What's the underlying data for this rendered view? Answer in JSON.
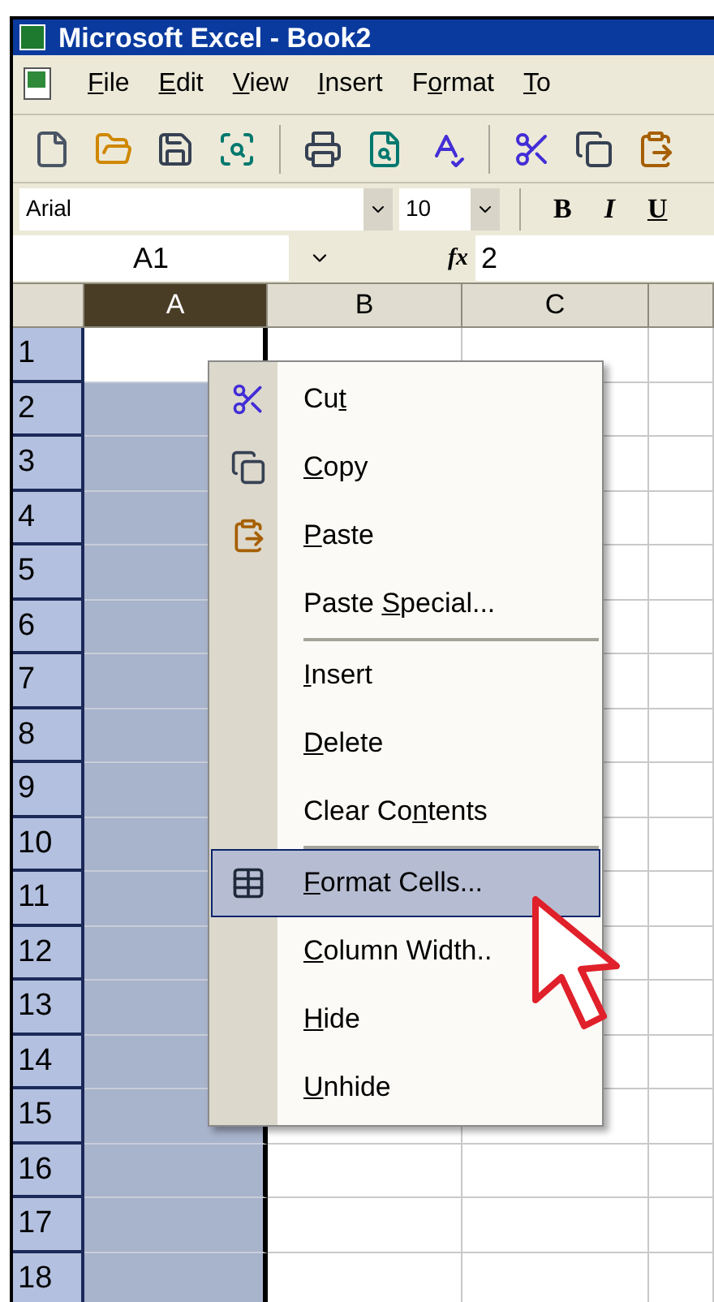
{
  "window": {
    "title": "Microsoft Excel - Book2"
  },
  "menu_bar": [
    {
      "key": "F",
      "after": "ile"
    },
    {
      "key": "E",
      "after": "dit"
    },
    {
      "key": "V",
      "after": "iew"
    },
    {
      "key": "I",
      "after": "nsert"
    },
    {
      "before": "F",
      "key": "o",
      "after": "rmat"
    },
    {
      "key": "T",
      "after": "o"
    }
  ],
  "toolbar": [
    {
      "kind": "new"
    },
    {
      "kind": "open"
    },
    {
      "kind": "save"
    },
    {
      "kind": "permission"
    },
    {
      "kind": "sep"
    },
    {
      "kind": "print"
    },
    {
      "kind": "preview"
    },
    {
      "kind": "spelling"
    },
    {
      "kind": "sep"
    },
    {
      "kind": "cut"
    },
    {
      "kind": "copy"
    },
    {
      "kind": "paste"
    }
  ],
  "formatting": {
    "font": "Arial",
    "size": "10",
    "bold": "B",
    "italic": "I",
    "underline": "U"
  },
  "formula_bar": {
    "name_box": "A1",
    "fx": "fx",
    "value": "2"
  },
  "columns": [
    {
      "label": "A",
      "selected": true
    },
    {
      "label": "B",
      "selected": false
    },
    {
      "label": "C",
      "selected": false
    },
    {
      "selected": false
    }
  ],
  "rows": [
    "1",
    "2",
    "3",
    "4",
    "5",
    "6",
    "7",
    "8",
    "9",
    "10",
    "11",
    "12",
    "13",
    "14",
    "15",
    "16",
    "17",
    "18"
  ],
  "context_menu": [
    {
      "kind": "cut",
      "before": "Cu",
      "key": "t",
      "selected": false
    },
    {
      "kind": "copy",
      "key": "C",
      "after": "opy",
      "selected": false
    },
    {
      "kind": "paste",
      "key": "P",
      "after": "aste",
      "selected": false
    },
    {
      "kind": "item",
      "before": "Paste ",
      "key": "S",
      "after": "pecial...",
      "selected": false
    },
    {
      "kind": "separator"
    },
    {
      "kind": "item",
      "key": "I",
      "after": "nsert",
      "selected": false
    },
    {
      "kind": "item",
      "key": "D",
      "after": "elete",
      "selected": false
    },
    {
      "kind": "item",
      "before": "Clear Co",
      "key": "n",
      "after": "tents",
      "selected": false
    },
    {
      "kind": "separator"
    },
    {
      "kind": "format",
      "key": "F",
      "after": "ormat Cells...",
      "selected": true
    },
    {
      "kind": "item",
      "key": "C",
      "after": "olumn Width..",
      "selected": false
    },
    {
      "kind": "item",
      "key": "H",
      "after": "ide",
      "selected": false
    },
    {
      "kind": "item",
      "key": "U",
      "after": "nhide",
      "selected": false
    }
  ]
}
